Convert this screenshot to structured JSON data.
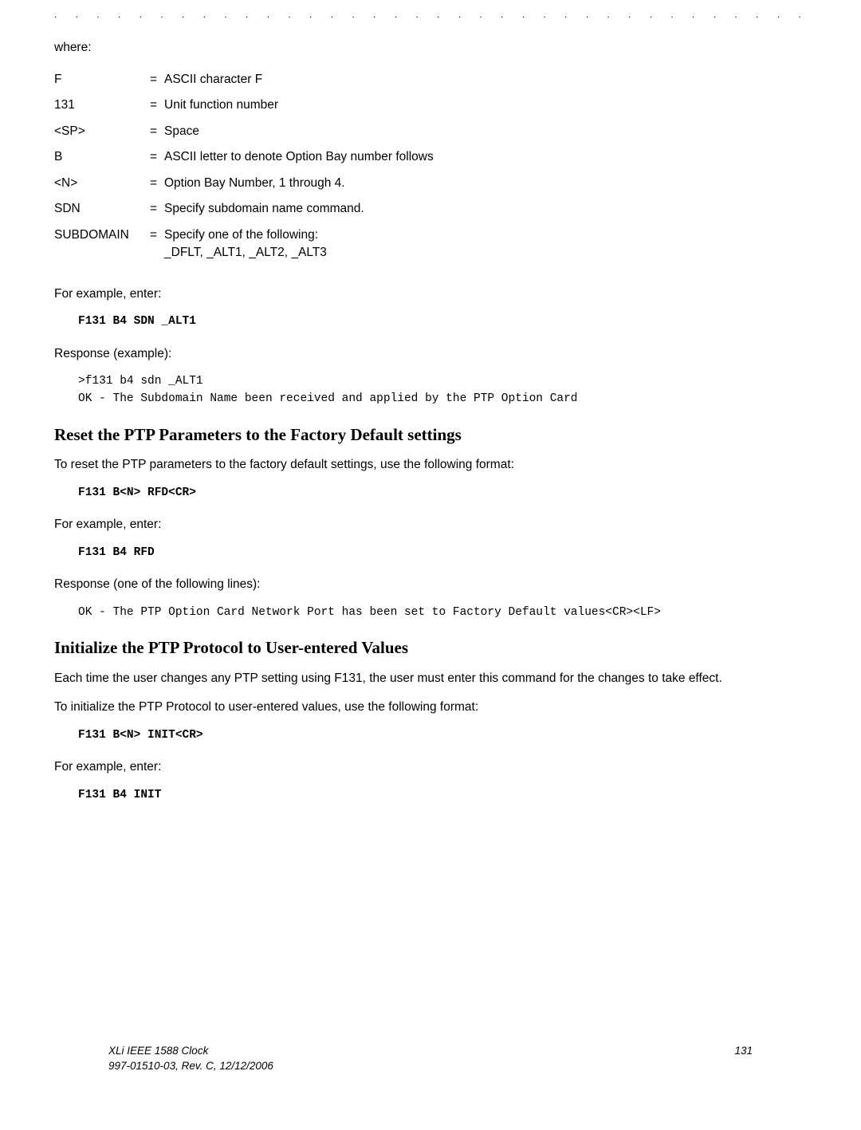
{
  "dots": ". . . . . . . . . . . . . . . . . . . . . . . . . . . . . . . . . . . . . . . . . . . .",
  "where_label": "where:",
  "defs": [
    {
      "term": "F",
      "eq": "=",
      "desc": "ASCII character F"
    },
    {
      "term": "131",
      "eq": "=",
      "desc": "Unit function number"
    },
    {
      "term": "<SP>",
      "eq": "=",
      "desc": "Space"
    },
    {
      "term": "B",
      "eq": "=",
      "desc": "ASCII letter to denote Option Bay number follows"
    },
    {
      "term": "<N>",
      "eq": "=",
      "desc": "Option Bay Number, 1 through 4."
    },
    {
      "term": "SDN",
      "eq": "=",
      "desc": "Specify subdomain name command."
    },
    {
      "term": "SUBDOMAIN",
      "eq": "=",
      "desc": "Specify one of the following:\n_DFLT, _ALT1, _ALT2, _ALT3"
    }
  ],
  "for_example_enter": "For example, enter:",
  "cmd1": "F131 B4 SDN _ALT1",
  "response_example": "Response (example):",
  "resp1": ">f131 b4 sdn _ALT1\nOK - The Subdomain Name been received and applied by the PTP Option Card",
  "heading_reset": "Reset the PTP Parameters to the Factory Default settings",
  "reset_intro": "To reset the PTP parameters to the factory default settings, use the following format:",
  "cmd2": "F131 B<N> RFD<CR>",
  "cmd3": "F131 B4 RFD",
  "response_one_of": "Response (one of the following lines):",
  "resp2": "OK - The PTP Option Card Network Port has been set to Factory Default values<CR><LF>",
  "heading_init": "Initialize the PTP Protocol to User-entered Values",
  "init_p1": "Each time the user changes any PTP setting using F131, the user must enter this command for the changes to take effect.",
  "init_p2": "To initialize the PTP Protocol to user-entered values, use the following format:",
  "cmd4": "F131 B<N> INIT<CR>",
  "cmd5": "F131 B4 INIT",
  "footer_title": "XLi IEEE 1588 Clock",
  "footer_rev": "997-01510-03, Rev. C, 12/12/2006",
  "page_number": "131"
}
